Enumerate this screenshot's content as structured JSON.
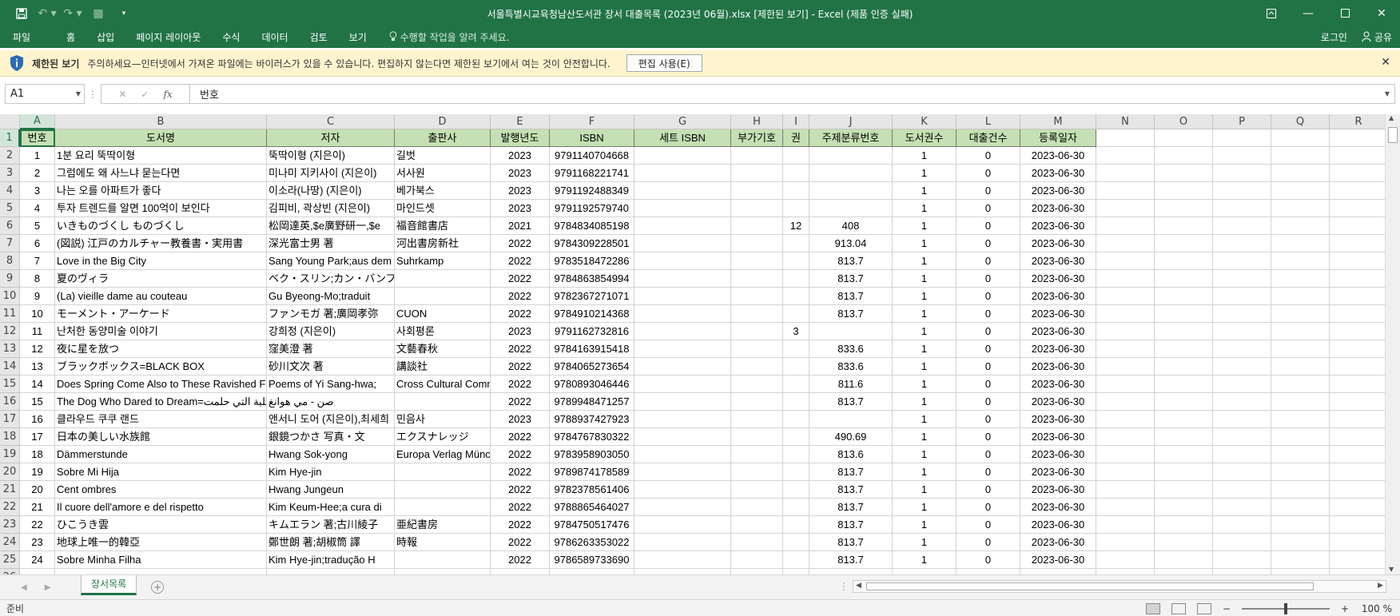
{
  "window": {
    "title": "서울특별시교육청남산도서관 장서 대출목록 (2023년 06월).xlsx  [제한된 보기] - Excel (제품 인증 실패)"
  },
  "ribbon": {
    "tabs": [
      "파일",
      "홈",
      "삽입",
      "페이지 레이아웃",
      "수식",
      "데이터",
      "검토",
      "보기"
    ],
    "tell_me": "수행할 작업을 알려 주세요.",
    "login": "로그인",
    "share": "공유"
  },
  "protected_view": {
    "title": "제한된 보기",
    "message": "주의하세요—인터넷에서 가져온 파일에는 바이러스가 있을 수 있습니다. 편집하지 않는다면 제한된 보기에서 여는 것이 안전합니다.",
    "enable_button": "편집 사용(E)"
  },
  "formula_bar": {
    "name_box": "A1",
    "fx": "fx",
    "value": "번호"
  },
  "sheet": {
    "columns": [
      "A",
      "B",
      "C",
      "D",
      "E",
      "F",
      "G",
      "H",
      "I",
      "J",
      "K",
      "L",
      "M",
      "N",
      "O",
      "P",
      "Q",
      "R"
    ],
    "header": [
      "번호",
      "도서명",
      "저자",
      "출판사",
      "발행년도",
      "ISBN",
      "세트 ISBN",
      "부가기호",
      "권",
      "주제분류번호",
      "도서권수",
      "대출건수",
      "등록일자"
    ],
    "rows": [
      [
        "1",
        "1분 요리 뚝딱이형",
        "뚝딱이형 (지은이)",
        "길벗",
        "2023",
        "9791140704668",
        "",
        "",
        "",
        "",
        "1",
        "0",
        "2023-06-30"
      ],
      [
        "2",
        "그럼에도 왜 사느냐 묻는다면",
        "미나미 지키사이 (지은이)",
        "서사원",
        "2023",
        "9791168221741",
        "",
        "",
        "",
        "",
        "1",
        "0",
        "2023-06-30"
      ],
      [
        "3",
        "나는 오를 아파트가 좋다",
        "이소라(나땅) (지은이)",
        "베가북스",
        "2023",
        "9791192488349",
        "",
        "",
        "",
        "",
        "1",
        "0",
        "2023-06-30"
      ],
      [
        "4",
        "투자 트렌드를 알면 100억이 보인다",
        "김피비, 곽상빈 (지은이)",
        "마인드셋",
        "2023",
        "9791192579740",
        "",
        "",
        "",
        "",
        "1",
        "0",
        "2023-06-30"
      ],
      [
        "5",
        "いきものづくし ものづくし",
        "松岡達英,$e廣野研一,$e",
        "福音館書店",
        "2021",
        "9784834085198",
        "",
        "",
        "12",
        "408",
        "1",
        "0",
        "2023-06-30"
      ],
      [
        "6",
        "(図説) 江戸のカルチャー教養書・実用書",
        "深光富士男 著",
        "河出書房新社",
        "2022",
        "9784309228501",
        "",
        "",
        "",
        "913.04",
        "1",
        "0",
        "2023-06-30"
      ],
      [
        "7",
        "Love in the Big City",
        "Sang Young Park;aus dem",
        "Suhrkamp",
        "2022",
        "9783518472286",
        "",
        "",
        "",
        "813.7",
        "1",
        "0",
        "2023-06-30"
      ],
      [
        "8",
        "夏のヴィラ",
        "ベク・スリン;カン・バンファ",
        "",
        "2022",
        "9784863854994",
        "",
        "",
        "",
        "813.7",
        "1",
        "0",
        "2023-06-30"
      ],
      [
        "9",
        "(La) vieille dame au couteau",
        "Gu Byeong-Mo;traduit",
        "",
        "2022",
        "9782367271071",
        "",
        "",
        "",
        "813.7",
        "1",
        "0",
        "2023-06-30"
      ],
      [
        "10",
        "モーメント・アーケード",
        "ファンモガ 著;廣岡孝弥",
        "CUON",
        "2022",
        "9784910214368",
        "",
        "",
        "",
        "813.7",
        "1",
        "0",
        "2023-06-30"
      ],
      [
        "11",
        "난처한 동양미술 이야기",
        "강희정 (지은이)",
        "사회평론",
        "2023",
        "9791162732816",
        "",
        "",
        "3",
        "",
        "1",
        "0",
        "2023-06-30"
      ],
      [
        "12",
        "夜に星を放つ",
        "窪美澄 著",
        "文藝春秋",
        "2022",
        "9784163915418",
        "",
        "",
        "",
        "833.6",
        "1",
        "0",
        "2023-06-30"
      ],
      [
        "13",
        "ブラックボックス=BLACK BOX",
        "砂川文次 著",
        "講談社",
        "2022",
        "9784065273654",
        "",
        "",
        "",
        "833.6",
        "1",
        "0",
        "2023-06-30"
      ],
      [
        "14",
        "Does Spring Come Also to These Ravished Fields",
        "Poems of Yi Sang-hwa;",
        "Cross Cultural Communications",
        "2022",
        "9780893046446",
        "",
        "",
        "",
        "811.6",
        "1",
        "0",
        "2023-06-30"
      ],
      [
        "15",
        "The Dog Who Dared to Dream=الكلبة التي حلمت",
        "صن - مي هوانغ",
        "",
        "2022",
        "9789948471257",
        "",
        "",
        "",
        "813.7",
        "1",
        "0",
        "2023-06-30"
      ],
      [
        "16",
        "클라우드 쿠쿠 랜드",
        "앤서니 도어 (지은이),최세희",
        "민음사",
        "2023",
        "9788937427923",
        "",
        "",
        "",
        "",
        "1",
        "0",
        "2023-06-30"
      ],
      [
        "17",
        "日本の美しい水族館",
        "銀鏡つかさ 写真・文",
        "エクスナレッジ",
        "2022",
        "9784767830322",
        "",
        "",
        "",
        "490.69",
        "1",
        "0",
        "2023-06-30"
      ],
      [
        "18",
        "Dämmerstunde",
        "Hwang Sok-yong",
        "Europa Verlag München",
        "2022",
        "9783958903050",
        "",
        "",
        "",
        "813.6",
        "1",
        "0",
        "2023-06-30"
      ],
      [
        "19",
        "Sobre Mi Hija",
        "Kim Hye-jin",
        "",
        "2022",
        "9789874178589",
        "",
        "",
        "",
        "813.7",
        "1",
        "0",
        "2023-06-30"
      ],
      [
        "20",
        "Cent ombres",
        "Hwang Jungeun",
        "",
        "2022",
        "9782378561406",
        "",
        "",
        "",
        "813.7",
        "1",
        "0",
        "2023-06-30"
      ],
      [
        "21",
        "Il cuore dell'amore e del rispetto",
        "Kim Keum-Hee;a cura di",
        "",
        "2022",
        "9788865464027",
        "",
        "",
        "",
        "813.7",
        "1",
        "0",
        "2023-06-30"
      ],
      [
        "22",
        "ひこうき雲",
        "キムエラン 著;古川綾子",
        "亜紀書房",
        "2022",
        "9784750517476",
        "",
        "",
        "",
        "813.7",
        "1",
        "0",
        "2023-06-30"
      ],
      [
        "23",
        "地球上唯一的韓亞",
        "鄭世朗 著;胡椒筒 譯",
        "時報",
        "2022",
        "9786263353022",
        "",
        "",
        "",
        "813.7",
        "1",
        "0",
        "2023-06-30"
      ],
      [
        "24",
        "Sobre Minha Filha",
        "Kim Hye-jin;tradução H",
        "",
        "2022",
        "9786589733690",
        "",
        "",
        "",
        "813.7",
        "1",
        "0",
        "2023-06-30"
      ]
    ]
  },
  "sheet_tab": "장서목록",
  "status": {
    "ready": "준비",
    "zoom": "100 %"
  }
}
